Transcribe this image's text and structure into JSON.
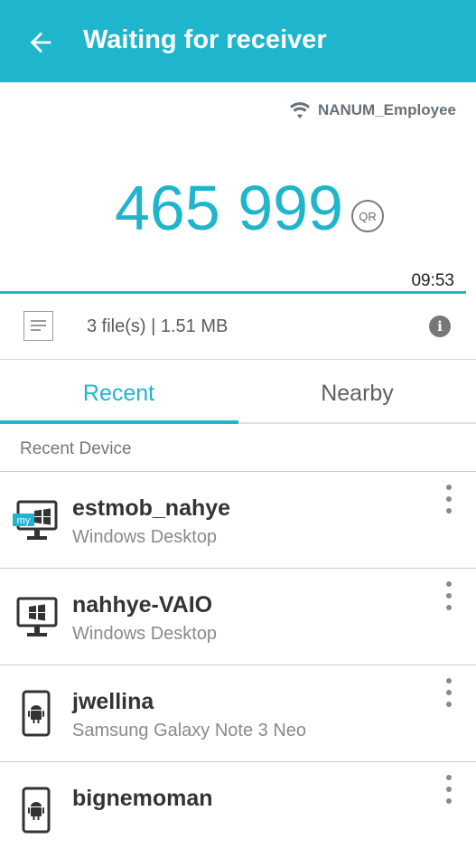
{
  "header": {
    "title": "Waiting for receiver",
    "back_icon": "arrow-left-icon",
    "bg_color": "#1fb5cc"
  },
  "network": {
    "ssid": "NANUM_Employee",
    "icon": "wifi-icon"
  },
  "transfer": {
    "code": "465 999",
    "qr_label": "QR",
    "timer": "09:53",
    "progress_fraction": 0.98
  },
  "files": {
    "summary": "3 file(s) | 1.51 MB",
    "info_label": "i"
  },
  "tabs": [
    {
      "label": "Recent",
      "active": true
    },
    {
      "label": "Nearby",
      "active": false
    }
  ],
  "section_label": "Recent Device",
  "devices": [
    {
      "name": "estmob_nahye",
      "type": "Windows Desktop",
      "icon": "desktop-windows-icon",
      "badge": "my"
    },
    {
      "name": "nahhye-VAIO",
      "type": "Windows Desktop",
      "icon": "desktop-windows-icon"
    },
    {
      "name": "jwellina",
      "type": "Samsung Galaxy Note 3 Neo",
      "icon": "android-phone-icon"
    },
    {
      "name": "bignemoman",
      "type": "",
      "icon": "android-phone-icon"
    }
  ]
}
